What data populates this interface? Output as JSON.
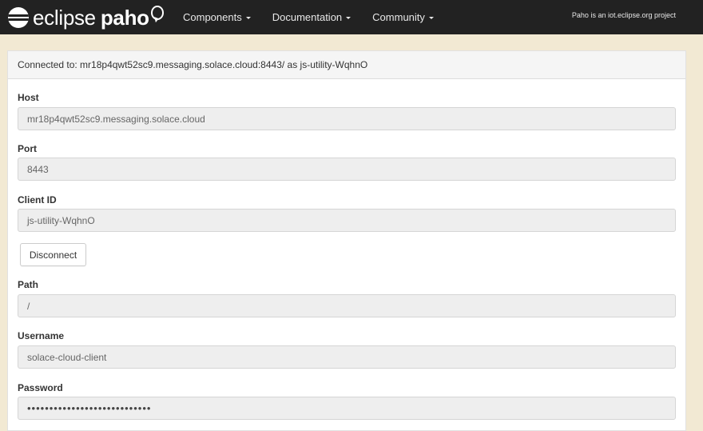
{
  "header": {
    "brand_text_1": "eclipse",
    "brand_text_2": "paho",
    "nav": [
      {
        "label": "Components"
      },
      {
        "label": "Documentation"
      },
      {
        "label": "Community"
      }
    ],
    "tagline": "Paho is an iot.eclipse.org project"
  },
  "panel": {
    "status": "Connected to: mr18p4qwt52sc9.messaging.solace.cloud:8443/ as js-utility-WqhnO"
  },
  "form": {
    "host_label": "Host",
    "host_value": "mr18p4qwt52sc9.messaging.solace.cloud",
    "port_label": "Port",
    "port_value": "8443",
    "client_id_label": "Client ID",
    "client_id_value": "js-utility-WqhnO",
    "disconnect_label": "Disconnect",
    "path_label": "Path",
    "path_value": "/",
    "username_label": "Username",
    "username_value": "solace-cloud-client",
    "password_label": "Password",
    "password_value": "••••••••••••••••••••••••••••"
  }
}
